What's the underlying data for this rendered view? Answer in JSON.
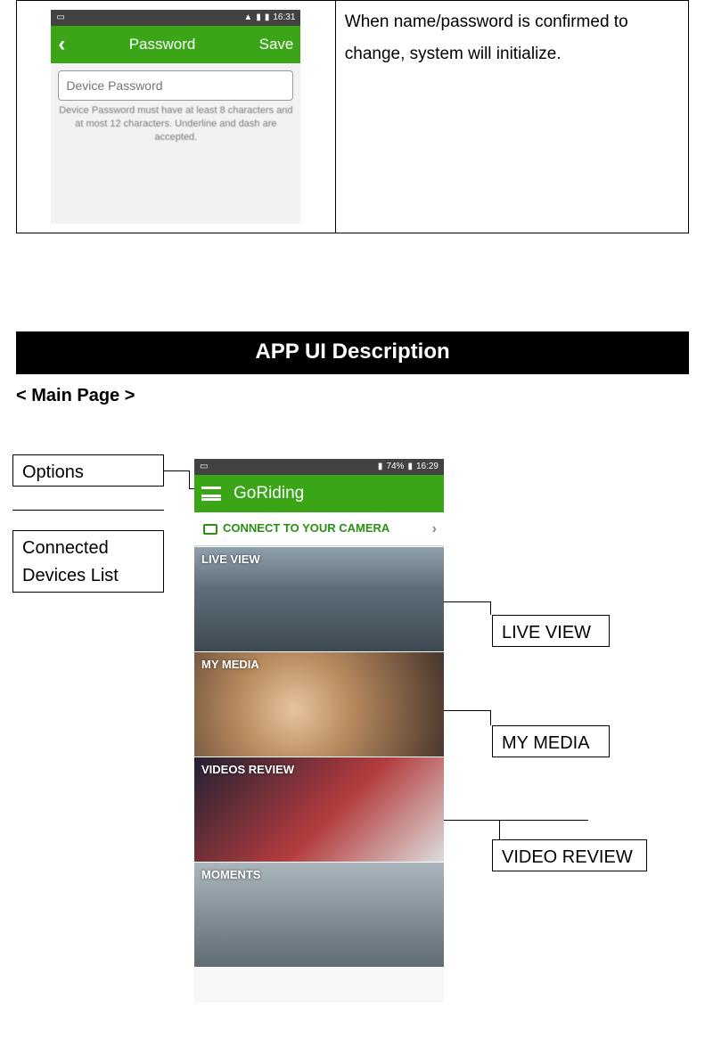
{
  "screenshot_pw": {
    "status_time": "16:31",
    "header_title": "Password",
    "header_back_glyph": "‹",
    "header_action": "Save",
    "input_placeholder": "Device Password",
    "hint": "Device Password must have at least 8 characters and at most 12 characters. Underline and dash are accepted."
  },
  "top_description": "When name/password is confirmed to change, system will initialize.",
  "section_header": "APP UI Description",
  "subheading": "< Main Page >",
  "callouts": {
    "options": "Options",
    "connected": "Connected Devices List",
    "liveview": "LIVE VIEW",
    "mymedia": "MY MEDIA",
    "videoreview": "VIDEO REVIEW"
  },
  "screenshot_main": {
    "status_time": "16:29",
    "status_battery": "74%",
    "app_title": "GoRiding",
    "connect_label": "CONNECT TO YOUR CAMERA",
    "tiles": {
      "liveview": "LIVE VIEW",
      "mymedia": "MY MEDIA",
      "videosreview": "VIDEOS REVIEW",
      "moments": "MOMENTS"
    }
  }
}
